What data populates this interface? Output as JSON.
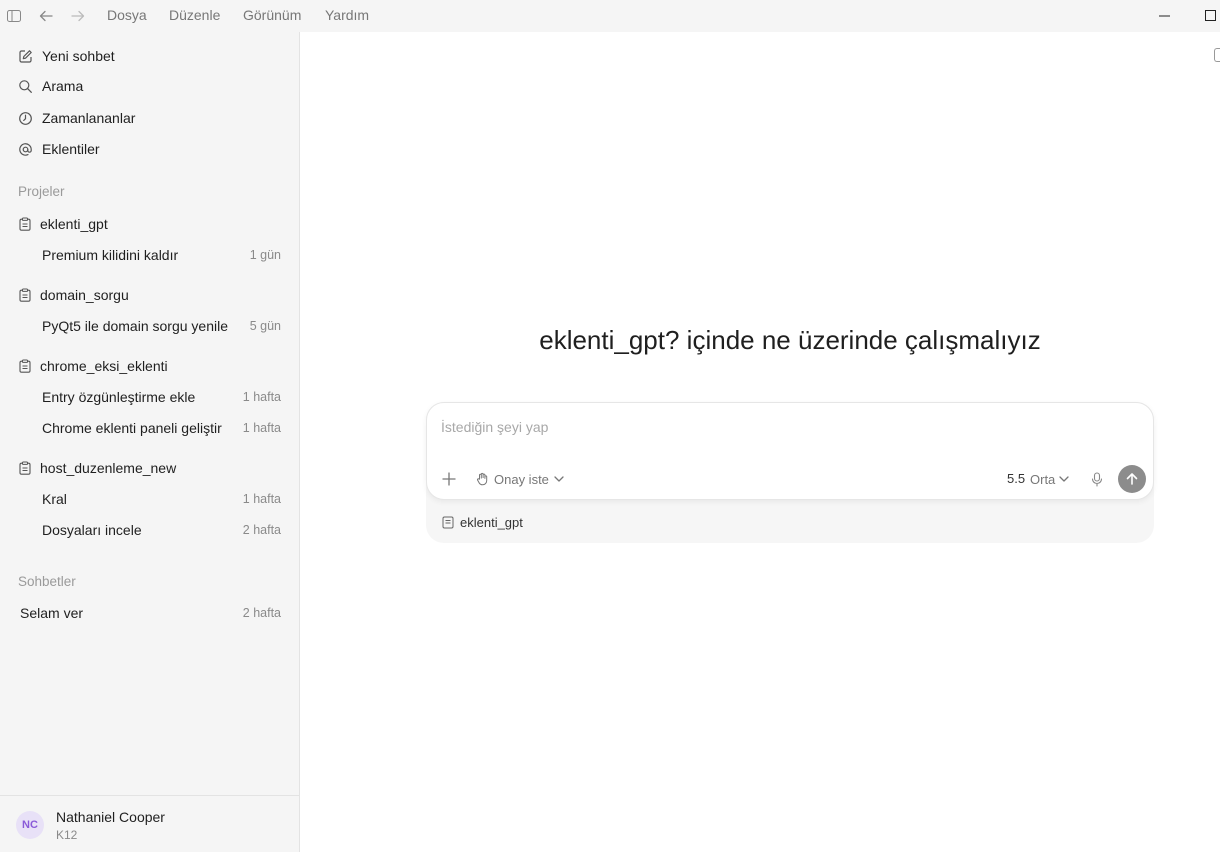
{
  "titlebar": {
    "menu": [
      "Dosya",
      "Düzenle",
      "Görünüm",
      "Yardım"
    ]
  },
  "sidebar": {
    "nav": [
      {
        "label": "Yeni sohbet",
        "icon": "edit-icon"
      },
      {
        "label": "Arama",
        "icon": "search-icon"
      },
      {
        "label": "Zamanlananlar",
        "icon": "clock-icon"
      },
      {
        "label": "Eklentiler",
        "icon": "at-icon"
      }
    ],
    "projects_label": "Projeler",
    "projects": [
      {
        "name": "eklenti_gpt",
        "threads": [
          {
            "title": "Premium kilidini kaldır",
            "age": "1 gün"
          }
        ]
      },
      {
        "name": "domain_sorgu",
        "threads": [
          {
            "title": "PyQt5 ile domain sorgu yenile",
            "age": "5 gün"
          }
        ]
      },
      {
        "name": "chrome_eksi_eklenti",
        "threads": [
          {
            "title": "Entry özgünleştirme ekle",
            "age": "1 hafta"
          },
          {
            "title": "Chrome eklenti paneli geliştir",
            "age": "1 hafta"
          }
        ]
      },
      {
        "name": "host_duzenleme_new",
        "threads": [
          {
            "title": "Kral",
            "age": "1 hafta"
          },
          {
            "title": "Dosyaları incele",
            "age": "2 hafta"
          }
        ]
      }
    ],
    "chats_label": "Sohbetler",
    "chats": [
      {
        "title": "Selam ver",
        "age": "2 hafta"
      }
    ],
    "user": {
      "initials": "NC",
      "name": "Nathaniel Cooper",
      "plan": "K12"
    }
  },
  "main": {
    "heading": "eklenti_gpt? içinde ne üzerinde çalışmalıyız",
    "composer": {
      "placeholder": "İstediğin şeyi yap",
      "approval_label": "Onay iste",
      "model_version": "5.5",
      "model_mode": "Orta"
    },
    "project_chip": "eklenti_gpt"
  },
  "colors": {
    "sidebar_bg": "#f5f5f5",
    "main_bg": "#ffffff",
    "avatar_bg": "#e8e1f7",
    "avatar_text": "#8a5bd8",
    "send_button": "#8c8c8c"
  }
}
